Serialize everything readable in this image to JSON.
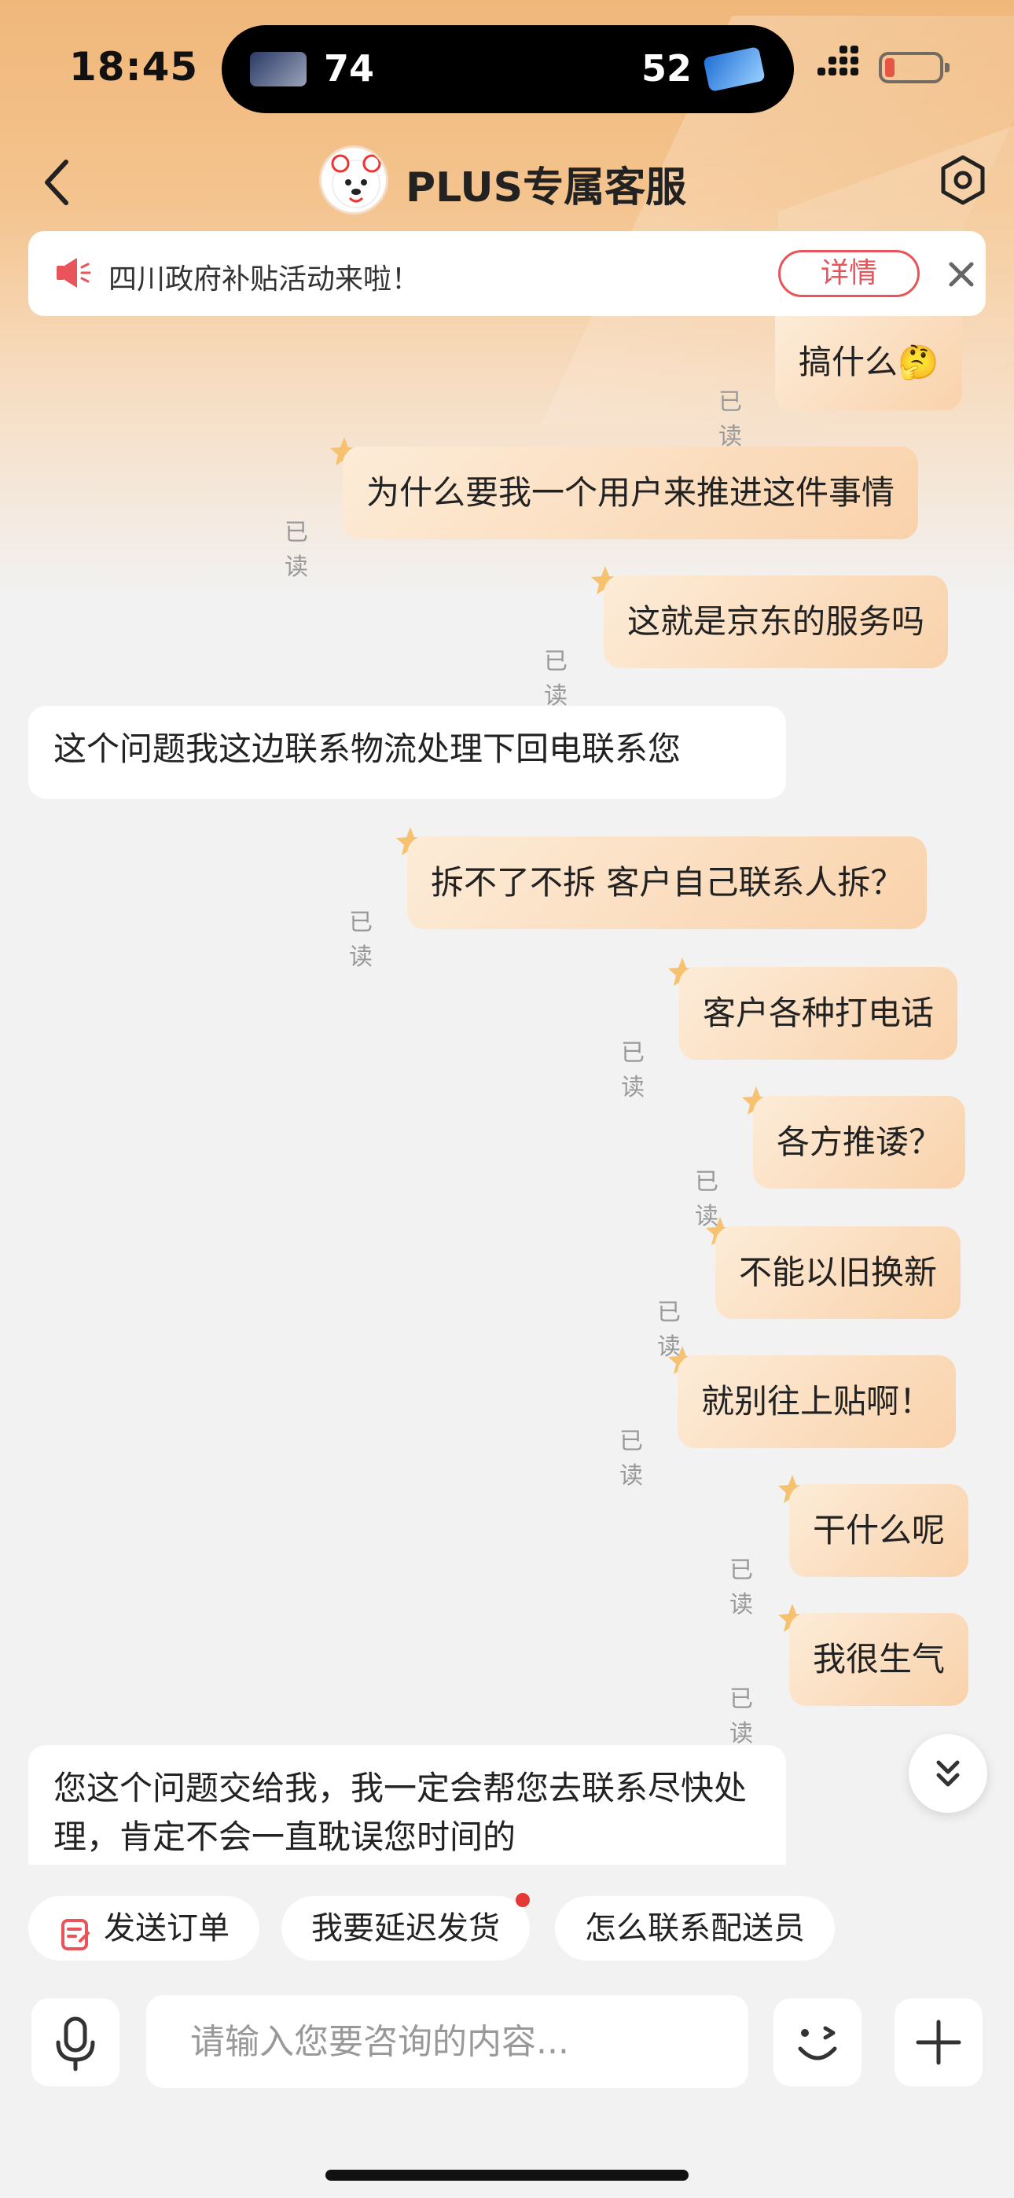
{
  "status_bar": {
    "time": "18:45",
    "live_activity": {
      "left_score": "74",
      "right_score": "52"
    }
  },
  "nav": {
    "title": "PLUS专属客服"
  },
  "notice": {
    "text": "四川政府补贴活动来啦！",
    "detail_label": "详情"
  },
  "messages": [
    {
      "from": "me",
      "text": "搞什么🤔",
      "status": "已读"
    },
    {
      "from": "me",
      "text": "为什么要我一个用户来推进这件事情",
      "status": "已读"
    },
    {
      "from": "me",
      "text": "这就是京东的服务吗",
      "status": "已读"
    },
    {
      "from": "agent",
      "text": "这个问题我这边联系物流处理下回电联系您"
    },
    {
      "from": "me",
      "text": "拆不了不拆 客户自己联系人拆？",
      "status": "已读"
    },
    {
      "from": "me",
      "text": "客户各种打电话",
      "status": "已读"
    },
    {
      "from": "me",
      "text": "各方推诿？",
      "status": "已读"
    },
    {
      "from": "me",
      "text": "不能以旧换新",
      "status": "已读"
    },
    {
      "from": "me",
      "text": "就别往上贴啊！",
      "status": "已读"
    },
    {
      "from": "me",
      "text": "干什么呢",
      "status": "已读"
    },
    {
      "from": "me",
      "text": "我很生气",
      "status": "已读"
    },
    {
      "from": "agent",
      "text": "您这个问题交给我，我一定会帮您去联系尽快处理，肯定不会一直耽误您时间的"
    }
  ],
  "quick_replies": [
    {
      "label": "发送订单",
      "icon": "order-icon"
    },
    {
      "label": "我要延迟发货",
      "badge": "red-dot"
    },
    {
      "label": "怎么联系配送员"
    }
  ],
  "input": {
    "placeholder": "请输入您要咨询的内容..."
  },
  "colors": {
    "outgoing_bubble": "#f9d2ab",
    "incoming_bubble": "#ffffff",
    "accent_red": "#e8545a",
    "header_gradient_top": "#f0b77a"
  }
}
